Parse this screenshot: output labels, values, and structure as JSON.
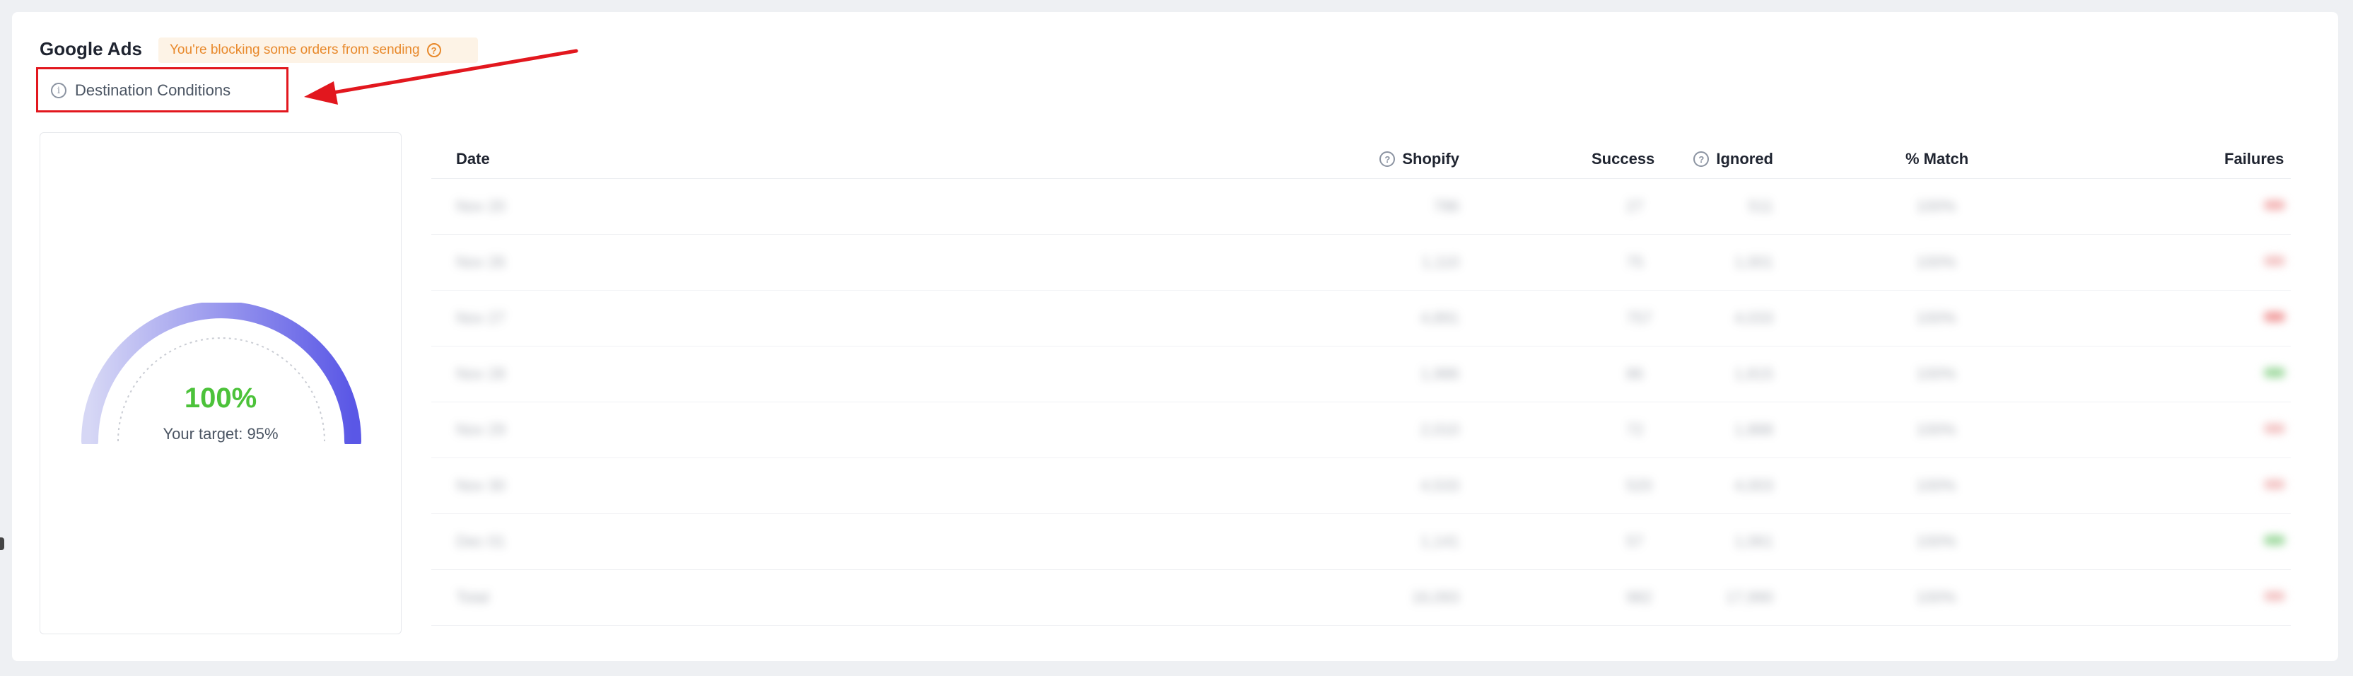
{
  "header": {
    "title": "Google Ads",
    "warning": "You're blocking some orders from sending",
    "destination_conditions": "Destination Conditions"
  },
  "gauge": {
    "value_label": "100%",
    "value_fraction": 1.0,
    "target_label": "Your target: 95%",
    "colors": {
      "start": "#d6d7f5",
      "end": "#5a57e6",
      "value": "#4cc23a"
    }
  },
  "table": {
    "columns": [
      "Date",
      "Shopify",
      "Ignored",
      "Success",
      "% Match",
      "Failures"
    ],
    "rows": [
      {
        "date": "Nov 20",
        "shopify": "786",
        "ignored": "511",
        "success": "27",
        "match": "100%",
        "failure_color": "#f3b4b4"
      },
      {
        "date": "Nov 26",
        "shopify": "1,110",
        "ignored": "1,001",
        "success": "75",
        "match": "100%",
        "failure_color": "#f3c4c4"
      },
      {
        "date": "Nov 27",
        "shopify": "4,891",
        "ignored": "4,033",
        "success": "757",
        "match": "100%",
        "failure_color": "#f09a9a"
      },
      {
        "date": "Nov 28",
        "shopify": "1,986",
        "ignored": "1,815",
        "success": "86",
        "match": "100%",
        "failure_color": "#9ed99e"
      },
      {
        "date": "Nov 29",
        "shopify": "2,010",
        "ignored": "1,888",
        "success": "72",
        "match": "100%",
        "failure_color": "#f3c4c4"
      },
      {
        "date": "Nov 30",
        "shopify": "4,533",
        "ignored": "4,003",
        "success": "520",
        "match": "100%",
        "failure_color": "#f3c4c4"
      },
      {
        "date": "Dec 01",
        "shopify": "1,141",
        "ignored": "1,061",
        "success": "57",
        "match": "100%",
        "failure_color": "#9ed99e"
      },
      {
        "date": "Total",
        "shopify": "16,093",
        "ignored": "17,990",
        "success": "982",
        "match": "100%",
        "failure_color": "#f3c4c4"
      }
    ]
  },
  "colors": {
    "annotation_red": "#e2171e",
    "warning_bg": "#fdf3e6",
    "warning_text": "#e8892b"
  }
}
